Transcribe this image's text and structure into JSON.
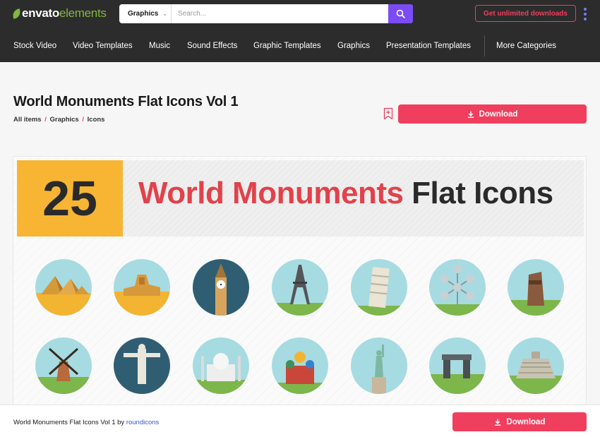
{
  "header": {
    "logo_main": "envato",
    "logo_sub": "elements",
    "search": {
      "category": "Graphics",
      "placeholder": "Search..."
    },
    "cta_label": "Get unlimited downloads"
  },
  "nav": {
    "items": [
      {
        "label": "Stock Video"
      },
      {
        "label": "Video Templates"
      },
      {
        "label": "Music"
      },
      {
        "label": "Sound Effects"
      },
      {
        "label": "Graphic Templates"
      },
      {
        "label": "Graphics"
      },
      {
        "label": "Presentation Templates"
      },
      {
        "label": "More Categories"
      }
    ]
  },
  "item": {
    "title": "World Monuments Flat Icons Vol 1",
    "breadcrumbs": [
      "All items",
      "Graphics",
      "Icons"
    ],
    "breadcrumb_sep": "/",
    "download_label": "Download"
  },
  "preview": {
    "badge_number": "25",
    "headline_red": "World Monuments",
    "headline_dark": "Flat Icons",
    "icons_row1": [
      "pyramids-icon",
      "sphinx-icon",
      "big-ben-icon",
      "eiffel-tower-icon",
      "leaning-tower-icon",
      "atomium-icon",
      "moai-icon"
    ],
    "icons_row2": [
      "windmill-icon",
      "christ-redeemer-icon",
      "taj-mahal-icon",
      "st-basils-icon",
      "statue-of-liberty-icon",
      "stonehenge-icon",
      "chichen-itza-icon"
    ]
  },
  "footer": {
    "title": "World Monuments Flat Icons Vol 1",
    "by": "by",
    "author": "roundicons",
    "download_label": "Download"
  },
  "colors": {
    "accent": "#f03e5e",
    "search_button": "#7b4cf5",
    "brand_green": "#82b541",
    "badge": "#f7b533",
    "headline_red": "#e1424b"
  }
}
